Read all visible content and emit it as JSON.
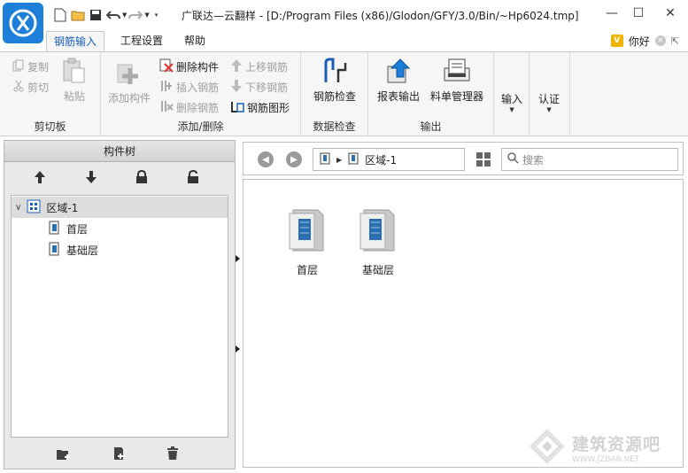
{
  "window": {
    "title": "广联达—云翻样 - [D:/Program Files (x86)/Glodon/GFY/3.0/Bin/~Hp6024.tmp]",
    "minimize": "—",
    "maximize": "☐",
    "close": "✕"
  },
  "tabs": [
    {
      "label": "钢筋输入",
      "active": true
    },
    {
      "label": "工程设置",
      "active": false
    },
    {
      "label": "帮助",
      "active": false
    }
  ],
  "user": {
    "vip_badge": "V",
    "greeting": "你好",
    "close": "×",
    "collapse": "⇱"
  },
  "ribbon": {
    "clipboard": {
      "label": "剪切板",
      "copy": "复制",
      "cut": "剪切",
      "paste": "粘贴"
    },
    "add_delete": {
      "label": "添加/删除",
      "add_component": "添加构件",
      "delete_component": "删除构件",
      "insert_rebar": "插入钢筋",
      "delete_rebar": "删除钢筋",
      "move_up_rebar": "上移钢筋",
      "move_down_rebar": "下移钢筋",
      "rebar_shape": "钢筋图形"
    },
    "data_check": {
      "label": "数据检查",
      "rebar_check": "钢筋检查"
    },
    "output": {
      "label": "输出",
      "report_output": "报表输出",
      "material_manager": "料单管理器"
    },
    "import_label": "输入",
    "certify_label": "认证"
  },
  "component_tree": {
    "title": "构件树",
    "nodes": [
      {
        "label": "区域-1",
        "level": 0,
        "expanded": true,
        "selected": true
      },
      {
        "label": "首层",
        "level": 1
      },
      {
        "label": "基础层",
        "level": 1
      }
    ]
  },
  "navigation": {
    "path_label": "区域-1",
    "search_placeholder": "搜索"
  },
  "content": {
    "items": [
      {
        "label": "首层"
      },
      {
        "label": "基础层"
      }
    ]
  },
  "watermark": {
    "cn": "建筑资源吧",
    "en": "WWW.JZBAR.NET"
  },
  "colors": {
    "accent": "#1a5fb4",
    "logo": "#1e7fd8",
    "ribbon_bg": "#f6f6f6"
  }
}
